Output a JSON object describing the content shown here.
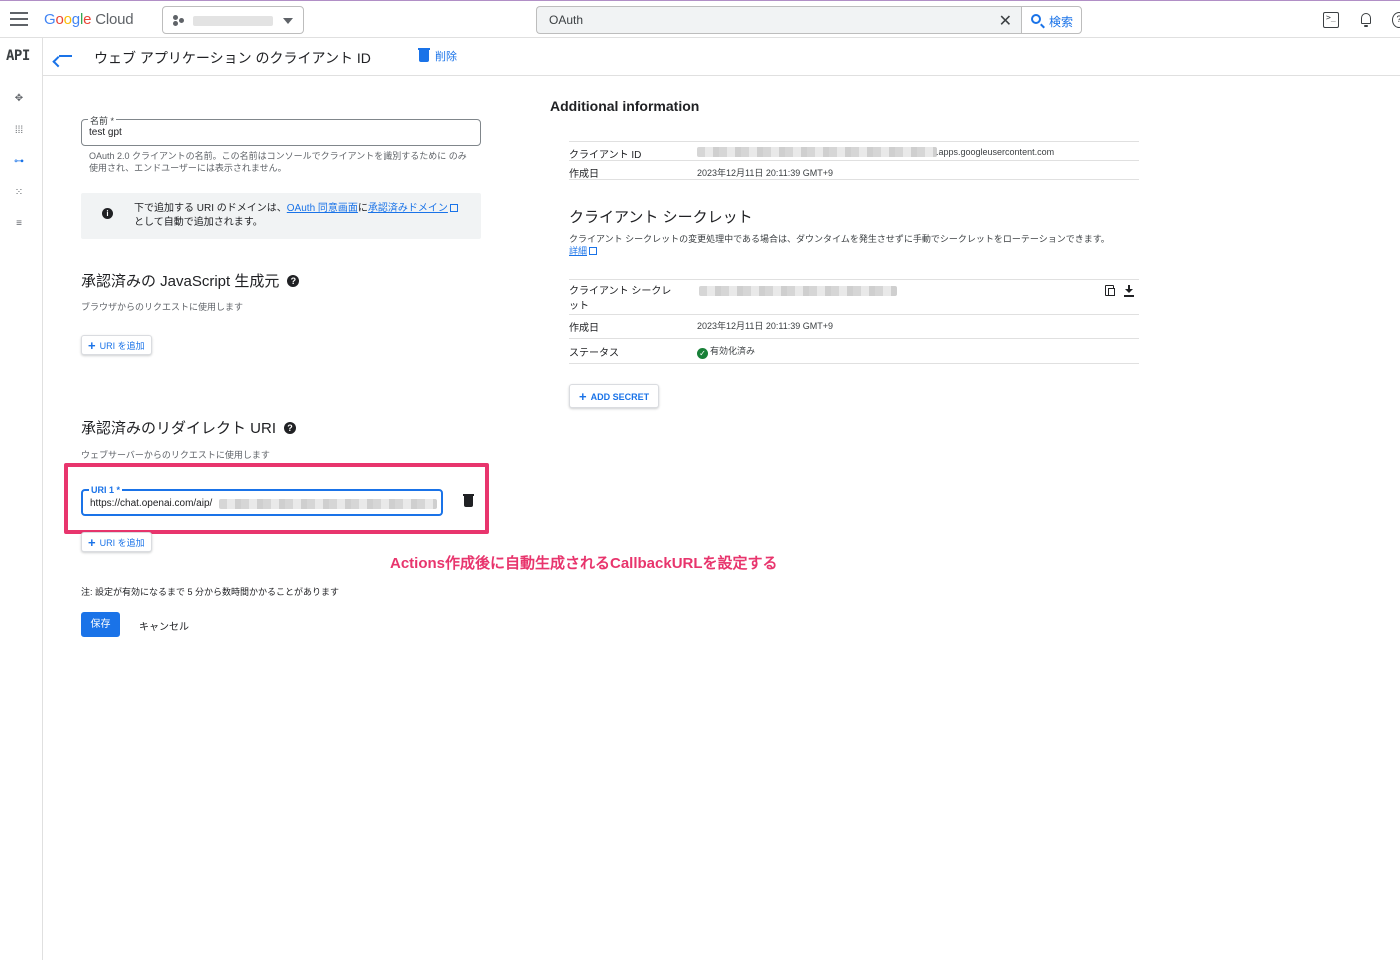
{
  "topbar": {
    "logo": {
      "g": "G",
      "o1": "o",
      "o2": "o",
      "g2": "g",
      "l": "l",
      "e": "e",
      "cloud": "Cloud"
    },
    "search": {
      "value": "OAuth",
      "button_label": "検索"
    }
  },
  "leftrail": {
    "api_label": "API"
  },
  "header": {
    "title": "ウェブ アプリケーション のクライアント ID",
    "delete_label": "削除"
  },
  "form": {
    "name_label": "名前 *",
    "name_value": "test gpt",
    "name_hint": "OAuth 2.0 クライアントの名前。この名前はコンソールでクライアントを識別するために のみ使用され、エンドユーザーには表示されません。",
    "notice_pre": "下で追加する URI のドメインは、",
    "notice_link1": "OAuth 同意画面",
    "notice_mid": "に",
    "notice_link2": "承認済みドメイン",
    "notice_post": "として自動で追加されます。",
    "js_title": "承認済みの JavaScript 生成元",
    "js_hint": "ブラウザからのリクエストに使用します",
    "add_uri_label": "URI を追加",
    "redirect_title": "承認済みのリダイレクト URI",
    "redirect_hint": "ウェブサーバーからのリクエストに使用します",
    "uri1_label": "URI 1 *",
    "uri1_value": "https://chat.openai.com/aip/",
    "note": "注: 設定が有効になるまで 5 分から数時間かかることがあります",
    "save_label": "保存",
    "cancel_label": "キャンセル"
  },
  "annotation": "Actions作成後に自動生成されるCallbackURLを設定する",
  "info": {
    "title": "Additional information",
    "client_id_label": "クライアント ID",
    "client_id_suffix": ".apps.googleusercontent.com",
    "created_label": "作成日",
    "created_value": "2023年12月11日 20:11:39 GMT+9",
    "secret_title": "クライアント シークレット",
    "secret_desc": "クライアント シークレットの変更処理中である場合は、ダウンタイムを発生させずに手動でシークレットをローテーションできます。",
    "secret_link": "詳細",
    "secret_label_line1": "クライアント シークレ",
    "secret_label_line2": "ット",
    "secret_created_label": "作成日",
    "secret_created_value": "2023年12月11日 20:11:39 GMT+9",
    "status_label": "ステータス",
    "status_value": "有効化済み",
    "add_secret_label": "ADD SECRET"
  },
  "colors": {
    "accent": "#1a73e8",
    "highlight": "#e8356d",
    "status_ok": "#188038"
  }
}
